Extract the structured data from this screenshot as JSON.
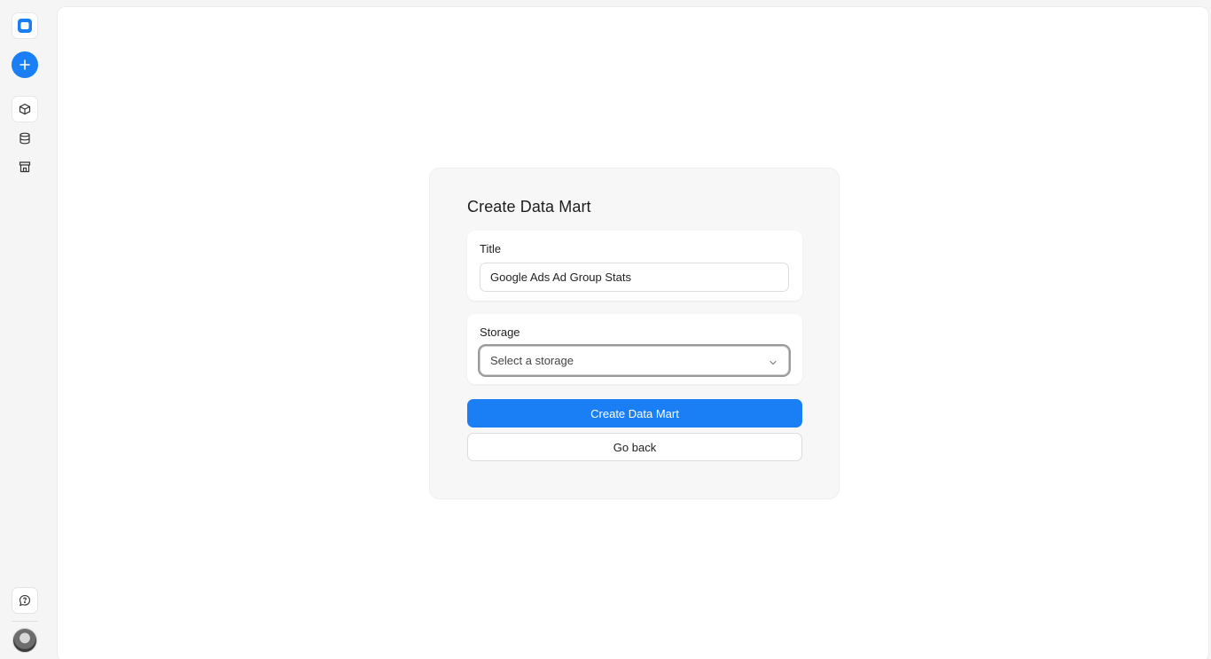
{
  "sidebar": {
    "icons": [
      "app-logo-icon",
      "plus-icon",
      "cube-icon",
      "database-icon",
      "store-icon",
      "chat-help-icon"
    ]
  },
  "form": {
    "title": "Create Data Mart",
    "title_field": {
      "label": "Title",
      "value": "Google Ads Ad Group Stats"
    },
    "storage_field": {
      "label": "Storage",
      "placeholder": "Select a storage"
    },
    "submit_label": "Create Data Mart",
    "back_label": "Go back"
  },
  "colors": {
    "accent": "#1a7ff5",
    "background": "#f5f5f5",
    "card": "#f7f7f7"
  }
}
